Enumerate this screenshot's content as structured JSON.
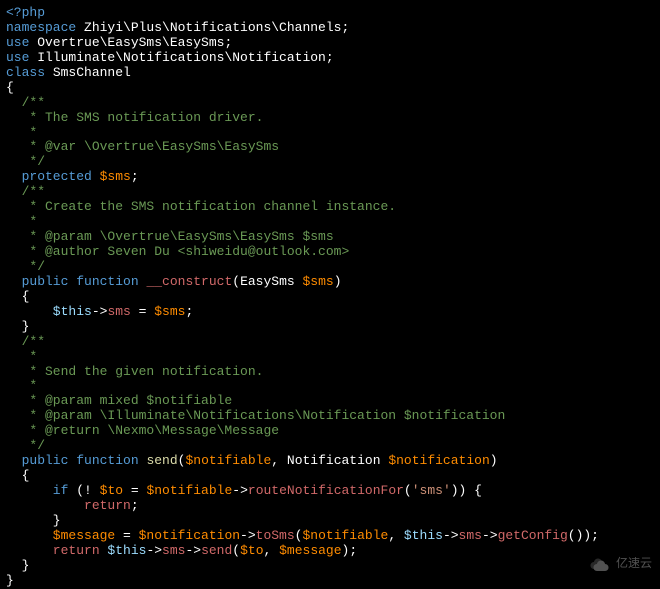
{
  "lines": {
    "l1_open": "<?php",
    "l2_ns": "namespace",
    "l2_path": " Zhiyi\\Plus\\Notifications\\Channels;",
    "l3_use": "use",
    "l3_path": " Overtrue\\EasySms\\EasySms;",
    "l4_use": "use",
    "l4_path": " Illuminate\\Notifications\\Notification;",
    "l5_class": "class",
    "l5_name": " SmsChannel",
    "l6": "{",
    "l7": "  /**",
    "l8": "   * The SMS notification driver.",
    "l9": "   *",
    "l10": "   * @var \\Overtrue\\EasySms\\EasySms",
    "l11": "   */",
    "l12_prot": "  protected ",
    "l12_var": "$sms",
    "l12_semi": ";",
    "l13": "  /**",
    "l14": "   * Create the SMS notification channel instance.",
    "l15": "   *",
    "l16": "   * @param \\Overtrue\\EasySms\\EasySms $sms",
    "l17": "   * @author Seven Du <shiweidu@outlook.com>",
    "l18": "   */",
    "l19_pub": "  public function ",
    "l19_con": "__construct",
    "l19_open": "(EasySms ",
    "l19_var": "$sms",
    "l19_close": ")",
    "l20": "  {",
    "l21_this": "      $this",
    "l21_arrow": "->",
    "l21_prop": "sms",
    "l21_eq": " = ",
    "l21_var": "$sms",
    "l21_semi": ";",
    "l22": "  }",
    "l23": "  /**",
    "l24": "   *",
    "l25": "   * Send the given notification.",
    "l26": "   *",
    "l27": "   * @param mixed $notifiable",
    "l28": "   * @param \\Illuminate\\Notifications\\Notification $notification",
    "l29": "   * @return \\Nexmo\\Message\\Message",
    "l30": "   */",
    "l31_pub": "  public function ",
    "l31_send": "send",
    "l31_p1": "(",
    "l31_v1": "$notifiable",
    "l31_c": ", Notification ",
    "l31_v2": "$notification",
    "l31_p2": ")",
    "l32": "  {",
    "l33_if": "      if",
    "l33_p1": " (! ",
    "l33_to": "$to",
    "l33_eq": " = ",
    "l33_not": "$notifiable",
    "l33_ar": "->",
    "l33_rn": "routeNotificationFor",
    "l33_p2": "(",
    "l33_str": "'sms'",
    "l33_p3": ")) {",
    "l34_ret": "          return",
    "l34_semi": ";",
    "l35": "      }",
    "l36_msg": "      $message",
    "l36_eq": " = ",
    "l36_not": "$notification",
    "l36_ar1": "->",
    "l36_ts": "toSms",
    "l36_p1": "(",
    "l36_nf": "$notifiable",
    "l36_c1": ", ",
    "l36_this": "$this",
    "l36_ar2": "->",
    "l36_sms": "sms",
    "l36_ar3": "->",
    "l36_gc": "getConfig",
    "l36_p2": "());",
    "l37_ret": "      return ",
    "l37_this": "$this",
    "l37_ar1": "->",
    "l37_sms": "sms",
    "l37_ar2": "->",
    "l37_send": "send",
    "l37_p1": "(",
    "l37_to": "$to",
    "l37_c": ", ",
    "l37_msg": "$message",
    "l37_p2": ");",
    "l38": "  }",
    "l39": "}"
  },
  "watermark": "亿速云"
}
